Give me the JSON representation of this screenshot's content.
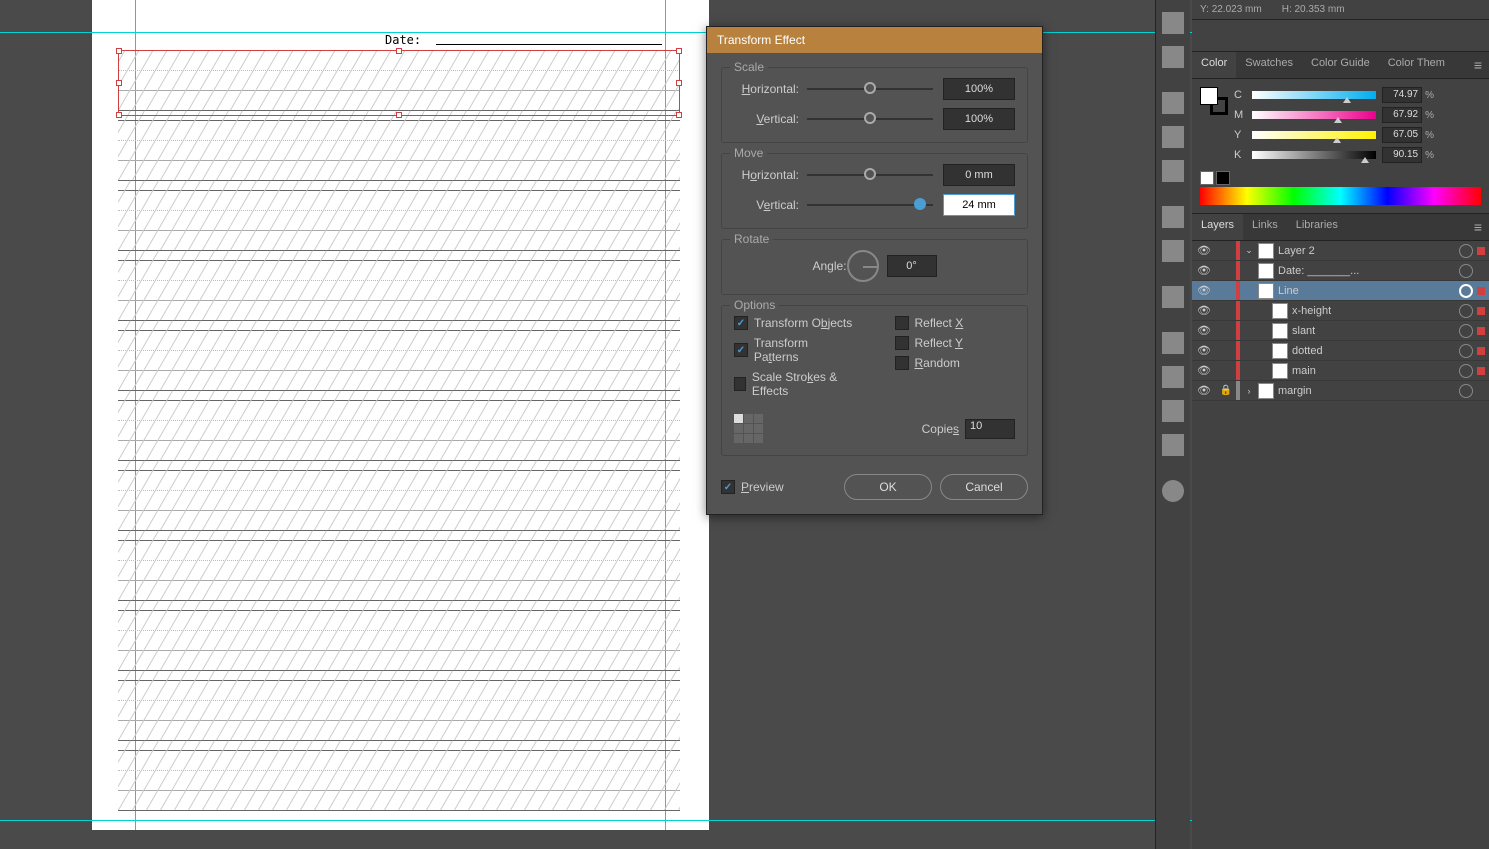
{
  "canvas": {
    "date_label": "Date:"
  },
  "dialog": {
    "title": "Transform Effect",
    "scale": {
      "label": "Scale",
      "horizontal_label": "Horizontal:",
      "vertical_label": "Vertical:",
      "horizontal_value": "100%",
      "vertical_value": "100%"
    },
    "move": {
      "label": "Move",
      "horizontal_label": "Horizontal:",
      "vertical_label": "Vertical:",
      "horizontal_value": "0 mm",
      "vertical_value": "24 mm"
    },
    "rotate": {
      "label": "Rotate",
      "angle_label": "Angle:",
      "angle_value": "0°"
    },
    "options": {
      "label": "Options",
      "transform_objects": "Transform Objects",
      "transform_patterns": "Transform Patterns",
      "scale_strokes": "Scale Strokes & Effects",
      "reflect_x": "Reflect X",
      "reflect_y": "Reflect Y",
      "random": "Random",
      "copies_label": "Copies",
      "copies_value": "10"
    },
    "preview_label": "Preview",
    "ok": "OK",
    "cancel": "Cancel"
  },
  "transform_panel": {
    "y_label": "Y:",
    "y_value": "22.023 mm",
    "h_label": "H:",
    "h_value": "20.353 mm"
  },
  "color_panel": {
    "tabs": {
      "color": "Color",
      "swatches": "Swatches",
      "color_guide": "Color Guide",
      "color_themes": "Color Them"
    },
    "c_label": "C",
    "c_value": "74.97",
    "m_label": "M",
    "m_value": "67.92",
    "y_label": "Y",
    "y_value": "67.05",
    "k_label": "K",
    "k_value": "90.15",
    "pct": "%"
  },
  "layers_panel": {
    "tabs": {
      "layers": "Layers",
      "links": "Links",
      "libraries": "Libraries"
    },
    "items": {
      "layer2": "Layer 2",
      "date": "Date: _______...",
      "line": "Line",
      "xheight": "x-height",
      "slant": "slant",
      "dotted": "dotted",
      "main": "main",
      "margin": "margin"
    }
  }
}
